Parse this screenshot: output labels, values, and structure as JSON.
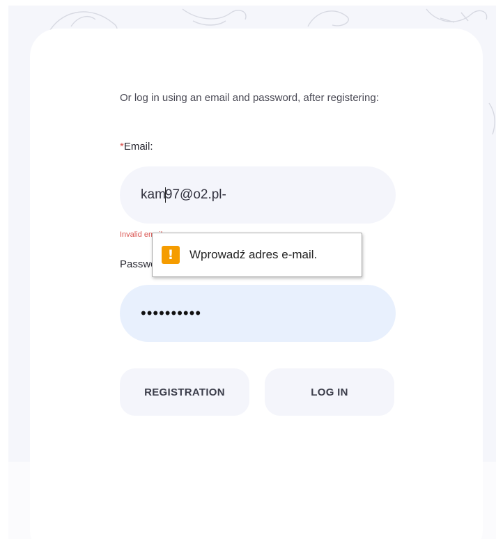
{
  "login_form": {
    "intro_text": "Or log in using an email and password, after registering:",
    "email_label": "Email:",
    "required_marker": "*",
    "email_value_before_caret": "kam",
    "email_value_after_caret": "97@o2.pl-",
    "email_error": "Invalid email",
    "password_label": "Password:",
    "password_masked": "••••••••••",
    "registration_button": "REGISTRATION",
    "login_button": "LOG IN"
  },
  "validation_tooltip": {
    "message": "Wprowadź adres e-mail.",
    "icon": "warning-icon",
    "icon_glyph": "!"
  },
  "colors": {
    "accent_required": "#d9534f",
    "warning": "#f59c00",
    "input_bg": "#f4f5fb",
    "autofill_bg": "#e8f0fd"
  }
}
